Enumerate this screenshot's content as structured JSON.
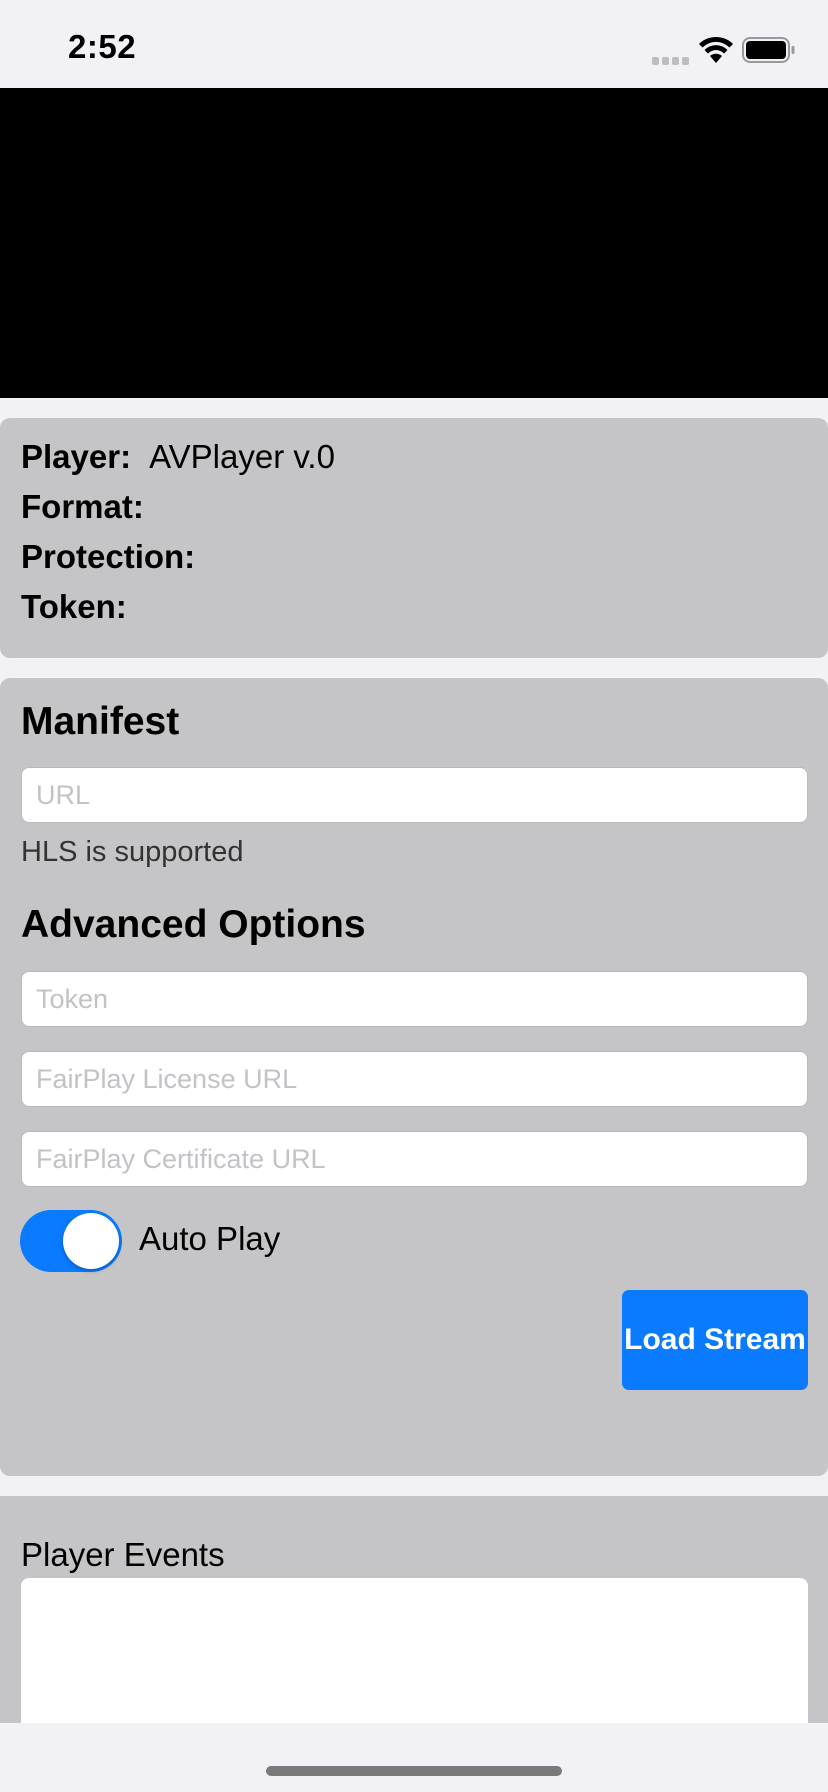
{
  "status_bar": {
    "time": "2:52",
    "icons": [
      "signal-icon",
      "wifi-icon",
      "battery-icon"
    ]
  },
  "player_info": {
    "player_label": "Player:",
    "player_value": "AVPlayer v.0",
    "format_label": "Format:",
    "format_value": "",
    "protection_label": "Protection:",
    "protection_value": "",
    "token_label": "Token:",
    "token_value": ""
  },
  "manifest": {
    "title": "Manifest",
    "url_value": "",
    "url_placeholder": "URL",
    "hint": "HLS is supported"
  },
  "advanced": {
    "title": "Advanced Options",
    "token_placeholder": "Token",
    "license_placeholder": "FairPlay License URL",
    "certificate_placeholder": "FairPlay Certificate URL",
    "autoplay_label": "Auto Play",
    "autoplay_on": true
  },
  "actions": {
    "load_label": "Load Stream"
  },
  "events": {
    "title": "Player Events",
    "log": ""
  },
  "colors": {
    "accent": "#0a7bff",
    "panel": "#c5c5c7",
    "background": "#f2f1f6"
  }
}
